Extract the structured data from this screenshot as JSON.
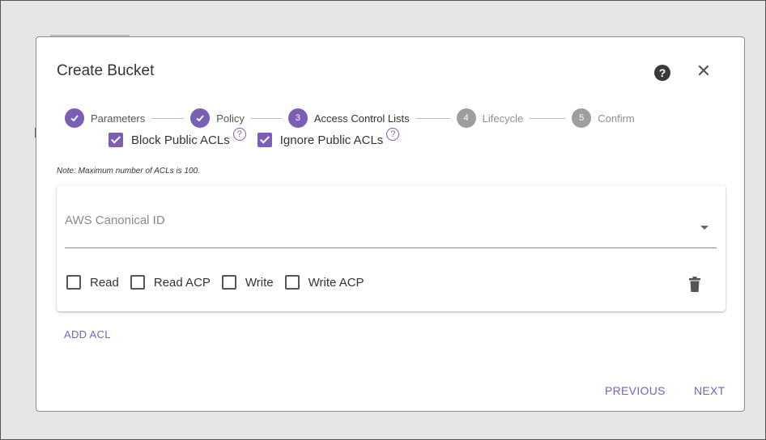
{
  "dialog": {
    "title": "Create Bucket",
    "help_icon": "help-circle-icon",
    "close_icon": "close-icon",
    "close_glyph": "✕",
    "help_glyph": "?"
  },
  "stepper": {
    "steps": [
      {
        "label": "Parameters",
        "state": "done",
        "number": "1"
      },
      {
        "label": "Policy",
        "state": "done",
        "number": "2"
      },
      {
        "label": "Access Control Lists",
        "state": "active",
        "number": "3"
      },
      {
        "label": "Lifecycle",
        "state": "pending",
        "number": "4"
      },
      {
        "label": "Confirm",
        "state": "pending",
        "number": "5"
      }
    ]
  },
  "public_acls": {
    "block": {
      "label": "Block Public ACLs",
      "checked": true
    },
    "ignore": {
      "label": "Ignore Public ACLs",
      "checked": true
    },
    "info_glyph": "?"
  },
  "note": "Note: Maximum number of ACLs is 100.",
  "acl_entry": {
    "canonical_id_label": "AWS Canonical ID",
    "canonical_id_value": "",
    "permissions": [
      {
        "label": "Read",
        "checked": false
      },
      {
        "label": "Read ACP",
        "checked": false
      },
      {
        "label": "Write",
        "checked": false
      },
      {
        "label": "Write ACP",
        "checked": false
      }
    ],
    "delete_icon": "trash-icon"
  },
  "actions": {
    "add_acl": "ADD ACL",
    "previous": "PREVIOUS",
    "next": "NEXT"
  },
  "colors": {
    "accent": "#7b5fb5",
    "pending": "#9e9e9e",
    "background": "#e6e6e6"
  }
}
